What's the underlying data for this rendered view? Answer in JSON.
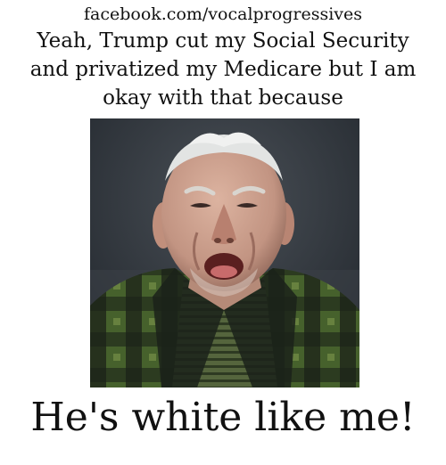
{
  "meme": {
    "source": "facebook.com/vocalprogressives",
    "top_lines": [
      "Yeah, Trump cut my Social Security",
      "and privatized my Medicare but I am",
      "okay with that because"
    ],
    "bottom_text": "He's white like me!"
  },
  "photo": {
    "subject": "elderly-man-photo",
    "colors": {
      "background": "#2b3138",
      "skin": "#c9a08c",
      "shirt_green": "#3f5a2a",
      "shirt_dark": "#141a14",
      "undershirt": "#4d5e38"
    }
  }
}
